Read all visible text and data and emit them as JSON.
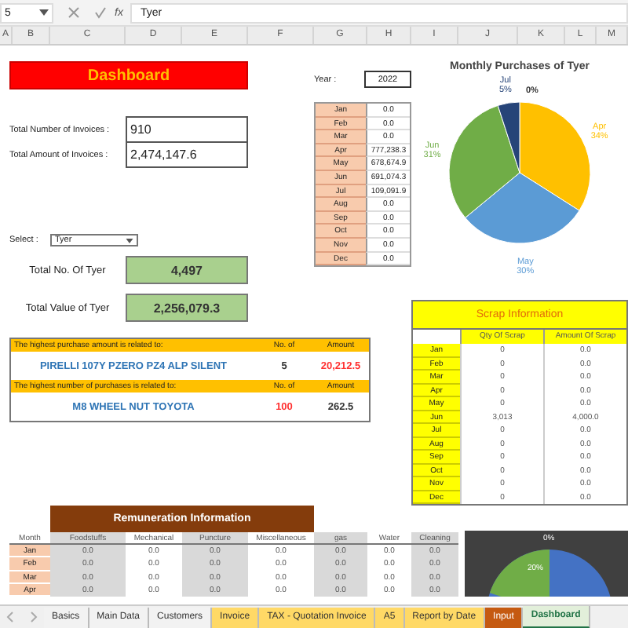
{
  "formula_bar": {
    "name_box": "5",
    "function_label": "fx",
    "value": "Tyer"
  },
  "columns": [
    "A",
    "B",
    "C",
    "D",
    "E",
    "F",
    "G",
    "H",
    "I",
    "J",
    "K",
    "L",
    "M"
  ],
  "dashboard": {
    "title": "Dashboard"
  },
  "invoices": [
    {
      "label": "Total Number of Invoices :",
      "value": "910"
    },
    {
      "label": "Total Amount of Invoices :",
      "value": "2,474,147.6"
    }
  ],
  "year": {
    "label": "Year :",
    "value": "2022"
  },
  "monthly": [
    {
      "month": "Jan",
      "value": "0.0"
    },
    {
      "month": "Feb",
      "value": "0.0"
    },
    {
      "month": "Mar",
      "value": "0.0"
    },
    {
      "month": "Apr",
      "value": "777,238.3"
    },
    {
      "month": "May",
      "value": "678,674.9"
    },
    {
      "month": "Jun",
      "value": "691,074.3"
    },
    {
      "month": "Jul",
      "value": "109,091.9"
    },
    {
      "month": "Aug",
      "value": "0.0"
    },
    {
      "month": "Sep",
      "value": "0.0"
    },
    {
      "month": "Oct",
      "value": "0.0"
    },
    {
      "month": "Nov",
      "value": "0.0"
    },
    {
      "month": "Dec",
      "value": "0.0"
    }
  ],
  "select": {
    "label": "Select :",
    "value": "Tyer"
  },
  "totals": [
    {
      "label": "Total No. Of Tyer",
      "value": "4,497"
    },
    {
      "label": "Total Value of Tyer",
      "value": "2,256,079.3"
    }
  ],
  "highest": [
    {
      "heading": "The highest purchase amount is related to:",
      "col_2": "No. of",
      "col_3": "Amount",
      "item": "PIRELLI 107Y PZERO PZ4 ALP SILENT",
      "count": "5",
      "amount": "20,212.5",
      "count_emphasized": false,
      "amount_emphasized": true
    },
    {
      "heading": "The highest number of purchases is related to:",
      "col_2": "No. of",
      "col_3": "Amount",
      "item": "M8 WHEEL NUT TOYOTA",
      "count": "100",
      "amount": "262.5",
      "count_emphasized": true,
      "amount_emphasized": false
    }
  ],
  "pie_chart": {
    "chart_data": {
      "type": "pie",
      "title": "Monthly Purchases of Tyer",
      "categories": [
        "Apr",
        "May",
        "Jun",
        "Jul"
      ],
      "values": [
        34,
        30,
        31,
        5
      ],
      "colors": [
        "#ffc000",
        "#5b9bd5",
        "#70ad47",
        "#264478"
      ],
      "value_labels": [
        "34%",
        "30%",
        "31%",
        "5%"
      ],
      "annotations": [
        "0%"
      ]
    }
  },
  "scrap": {
    "title": "Scrap Information",
    "columns": [
      "Qty Of Scrap",
      "Amount Of Scrap"
    ],
    "rows": [
      {
        "month": "Jan",
        "qty": "0",
        "amount": "0.0"
      },
      {
        "month": "Feb",
        "qty": "0",
        "amount": "0.0"
      },
      {
        "month": "Mar",
        "qty": "0",
        "amount": "0.0"
      },
      {
        "month": "Apr",
        "qty": "0",
        "amount": "0.0"
      },
      {
        "month": "May",
        "qty": "0",
        "amount": "0.0"
      },
      {
        "month": "Jun",
        "qty": "3,013",
        "amount": "4,000.0"
      },
      {
        "month": "Jul",
        "qty": "0",
        "amount": "0.0"
      },
      {
        "month": "Aug",
        "qty": "0",
        "amount": "0.0"
      },
      {
        "month": "Sep",
        "qty": "0",
        "amount": "0.0"
      },
      {
        "month": "Oct",
        "qty": "0",
        "amount": "0.0"
      },
      {
        "month": "Nov",
        "qty": "0",
        "amount": "0.0"
      },
      {
        "month": "Dec",
        "qty": "0",
        "amount": "0.0"
      }
    ]
  },
  "remuneration": {
    "title": "Remuneration Information",
    "columns": [
      "Month",
      "Foodstuffs",
      "Mechanical",
      "Puncture",
      "Miscellaneous",
      "gas",
      "Water",
      "Cleaning"
    ],
    "rows": [
      {
        "month": "Jan",
        "values": [
          "0.0",
          "0.0",
          "0.0",
          "0.0",
          "0.0",
          "0.0",
          "0.0"
        ]
      },
      {
        "month": "Feb",
        "values": [
          "0.0",
          "0.0",
          "0.0",
          "0.0",
          "0.0",
          "0.0",
          "0.0"
        ]
      },
      {
        "month": "Mar",
        "values": [
          "0.0",
          "0.0",
          "0.0",
          "0.0",
          "0.0",
          "0.0",
          "0.0"
        ]
      },
      {
        "month": "Apr",
        "values": [
          "0.0",
          "0.0",
          "0.0",
          "0.0",
          "0.0",
          "0.0",
          "0.0"
        ]
      }
    ]
  },
  "second_chart": {
    "labels": [
      "0%",
      "20%"
    ]
  },
  "sheet_tabs": [
    {
      "label": "Basics",
      "color": "#f2f2f2",
      "selected": false
    },
    {
      "label": "Main Data",
      "color": "#f2f2f2",
      "selected": false
    },
    {
      "label": "Customers",
      "color": "#f2f2f2",
      "selected": false
    },
    {
      "label": "Invoice",
      "color": "#ffd966",
      "selected": false
    },
    {
      "label": "TAX - Quotation Invoice",
      "color": "#ffd966",
      "selected": false
    },
    {
      "label": "A5",
      "color": "#ffd966",
      "selected": false
    },
    {
      "label": "Report by Date",
      "color": "#ffd966",
      "selected": false
    },
    {
      "label": "Input",
      "color": "#c55a11",
      "selected": false
    },
    {
      "label": "Dashboard",
      "color": "#e2efda",
      "selected": true
    }
  ]
}
